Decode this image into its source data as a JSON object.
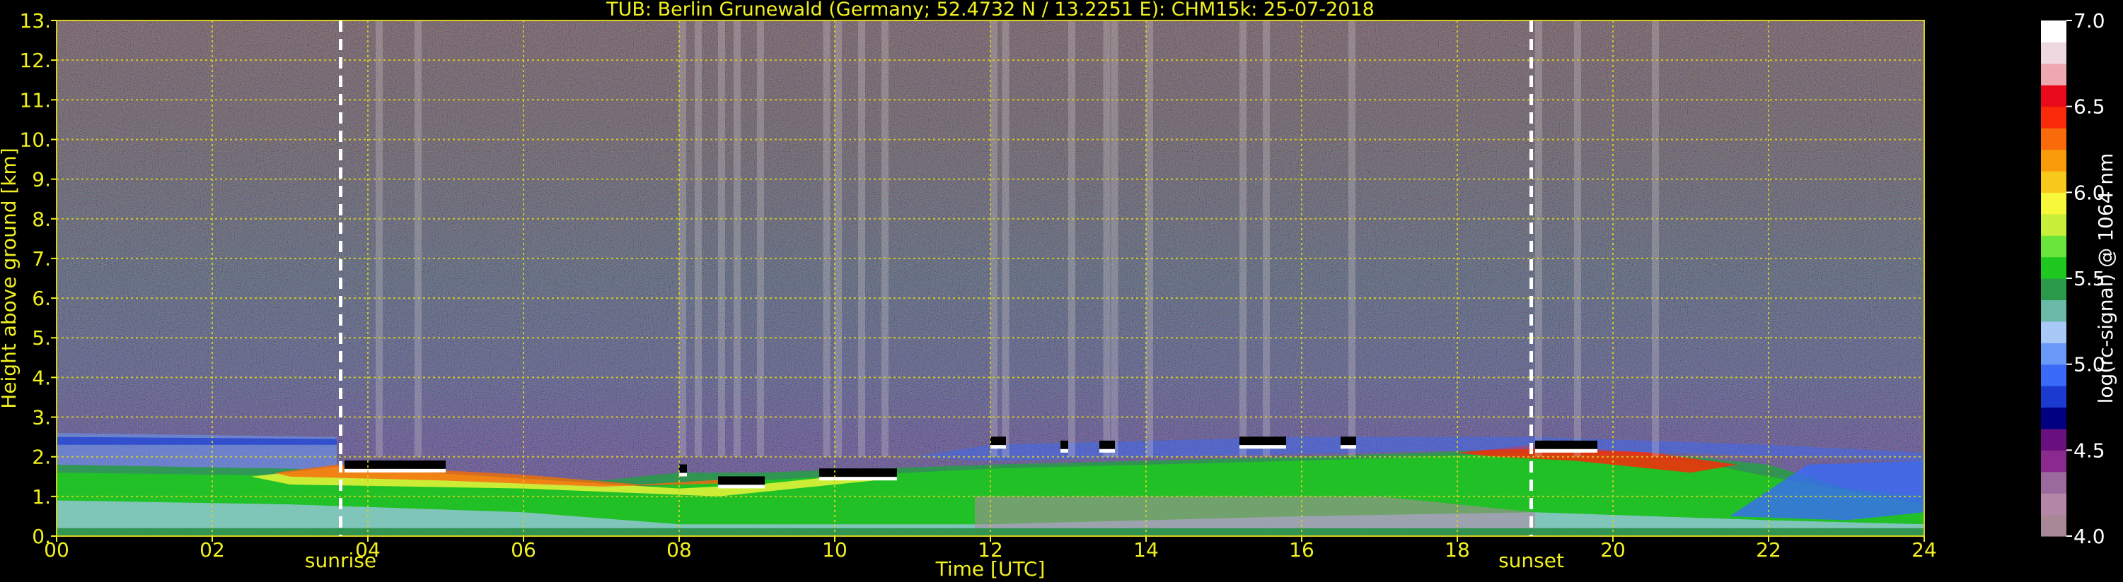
{
  "chart_data": {
    "type": "heatmap",
    "title": "TUB: Berlin Grunewald (Germany; 52.4732 N / 13.2251 E):    CHM15k: 25-07-2018",
    "xlabel": "Time [UTC]",
    "ylabel": "Height above ground [km]",
    "xlim": [
      0,
      24
    ],
    "ylim": [
      0,
      13
    ],
    "x_ticks": [
      0,
      2,
      4,
      6,
      8,
      10,
      12,
      14,
      16,
      18,
      20,
      22,
      24
    ],
    "x_tick_labels": [
      "00",
      "02",
      "04",
      "06",
      "08",
      "10",
      "12",
      "14",
      "16",
      "18",
      "20",
      "22",
      "24"
    ],
    "y_ticks": [
      0,
      1,
      2,
      3,
      4,
      5,
      6,
      7,
      8,
      9,
      10,
      11,
      12,
      13
    ],
    "y_tick_labels": [
      "0.",
      "1.",
      "2.",
      "3.",
      "4.",
      "5.",
      "6.",
      "7.",
      "8.",
      "9.",
      "10.",
      "11.",
      "12.",
      "13."
    ],
    "grid": true,
    "markers": [
      {
        "label": "sunrise",
        "x": 3.65
      },
      {
        "label": "sunset",
        "x": 18.95
      }
    ],
    "colorbar": {
      "label": "log(rc-signal) @ 1064 nm",
      "range": [
        4.0,
        7.0
      ],
      "ticks": [
        4.0,
        4.5,
        5.0,
        5.5,
        6.0,
        6.5,
        7.0
      ],
      "tick_labels": [
        "4.0",
        "4.5",
        "5.0",
        "5.5",
        "6.0",
        "6.5",
        "7.0"
      ],
      "colors": [
        "#a88896",
        "#b487a8",
        "#9a6a9c",
        "#8a2a8e",
        "#6a107e",
        "#000080",
        "#1a3ad0",
        "#3a6af8",
        "#6a9af8",
        "#a8c8f8",
        "#6ab8a8",
        "#2a9a4a",
        "#1ec81e",
        "#6ae63a",
        "#c8f03a",
        "#f8f83a",
        "#f8c81a",
        "#f89a0a",
        "#f86a0a",
        "#f82a0a",
        "#e80a1a",
        "#f0a8b0",
        "#f0d8e0",
        "#ffffff"
      ]
    },
    "cloud_base_events": [
      {
        "x": 3.7,
        "x_end": 5.0,
        "height": 1.8
      },
      {
        "x": 8.0,
        "x_end": 8.1,
        "height": 1.7
      },
      {
        "x": 8.5,
        "x_end": 9.1,
        "height": 1.4
      },
      {
        "x": 9.8,
        "x_end": 10.8,
        "height": 1.6
      },
      {
        "x": 12.0,
        "x_end": 12.2,
        "height": 2.4
      },
      {
        "x": 12.9,
        "x_end": 13.0,
        "height": 2.3
      },
      {
        "x": 13.4,
        "x_end": 13.6,
        "height": 2.3
      },
      {
        "x": 15.2,
        "x_end": 15.8,
        "height": 2.4
      },
      {
        "x": 16.5,
        "x_end": 16.7,
        "height": 2.4
      },
      {
        "x": 19.0,
        "x_end": 19.8,
        "height": 2.3
      }
    ]
  }
}
